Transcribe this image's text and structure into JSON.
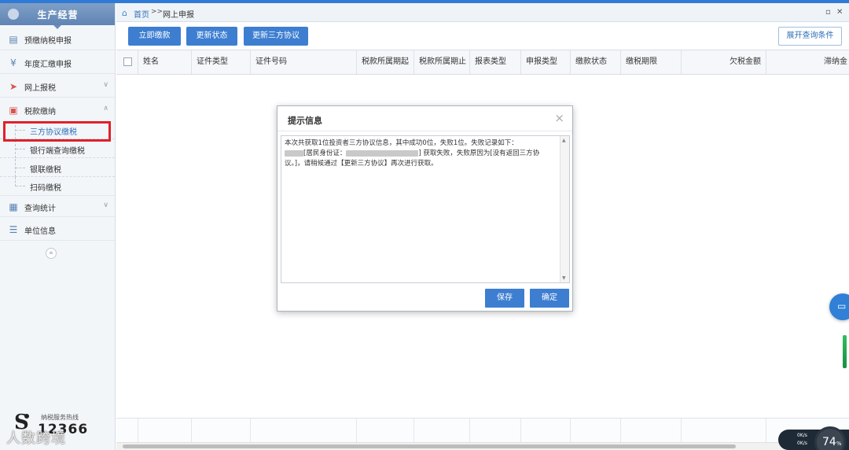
{
  "sidebar": {
    "title": "生产经营",
    "items": [
      {
        "label": "预缴纳税申报",
        "icon": "document-icon"
      },
      {
        "label": "年度汇缴申报",
        "icon": "yen-icon"
      },
      {
        "label": "网上报税",
        "icon": "send-icon"
      },
      {
        "label": "税款缴纳",
        "icon": "cashier-icon"
      },
      {
        "label": "查询统计",
        "icon": "report-icon"
      },
      {
        "label": "单位信息",
        "icon": "list-icon"
      }
    ],
    "subitems": [
      {
        "label": "三方协议缴税"
      },
      {
        "label": "银行端查询缴税"
      },
      {
        "label": "银联缴税"
      },
      {
        "label": "扫码缴税"
      }
    ],
    "hotline_label": "纳税服务热线",
    "hotline_number": "12366",
    "watermark": "人数跨境"
  },
  "breadcrumb": {
    "home": "首页",
    "separator": ">>",
    "current": "网上申报"
  },
  "toolbar": {
    "pay_now": "立即缴款",
    "update_status": "更新状态",
    "update_agreement": "更新三方协议",
    "expand_query": "展开查询条件"
  },
  "grid": {
    "columns": [
      "姓名",
      "证件类型",
      "证件号码",
      "税款所属期起",
      "税款所属期止",
      "报表类型",
      "申报类型",
      "缴款状态",
      "缴税期限",
      "欠税金额",
      "滞纳金"
    ]
  },
  "dialog": {
    "title": "提示信息",
    "line1": "本次共获取1位投资者三方协议信息，其中成功0位，失败1位。失败记录如下：",
    "line2_a": "[居民身份证：",
    "line2_b": "] 获取失败，失败原因为[没有返回三方协",
    "line3": "议。]，请稍候通过【更新三方协议】再次进行获取。",
    "save": "保存",
    "confirm": "确定"
  },
  "widgets": {
    "net_up": "0K/s",
    "net_down": "0K/s",
    "usage_percent": "74",
    "percent_sign": "%"
  }
}
